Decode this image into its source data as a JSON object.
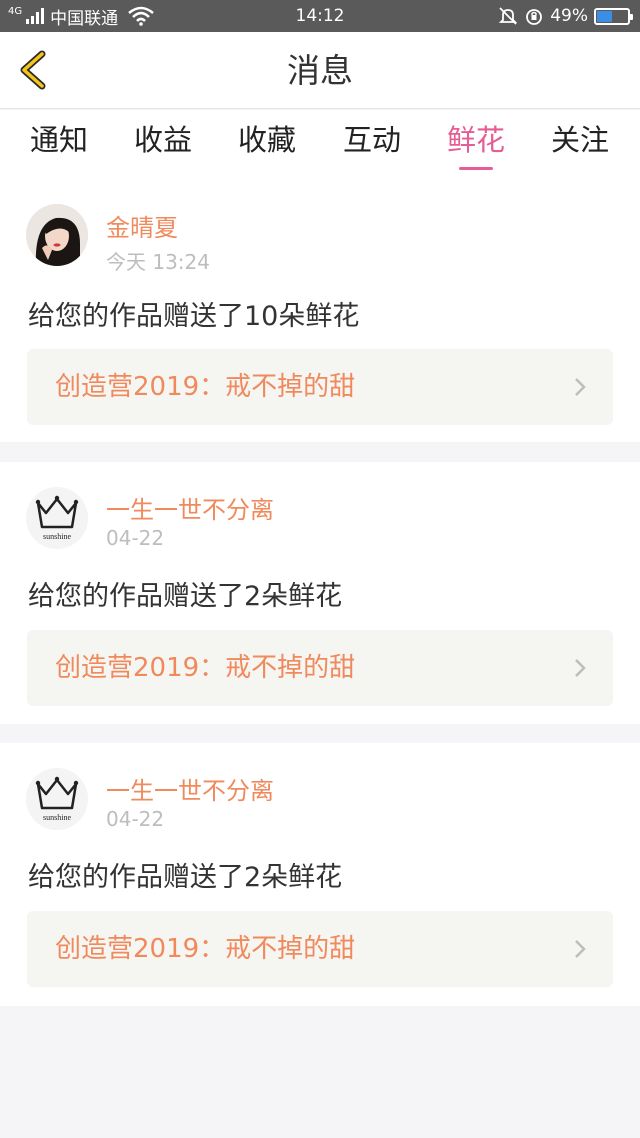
{
  "status_bar": {
    "network": "4G",
    "carrier": "中国联通",
    "time": "14:12",
    "battery": "49%",
    "battery_level": 0.49,
    "icons": [
      "signal-icon",
      "wifi-icon",
      "mute-icon",
      "alarm-icon",
      "battery-icon"
    ]
  },
  "header": {
    "title": "消息",
    "back_icon": "chevron-left-icon"
  },
  "tabs": [
    {
      "label": "通知",
      "active": false
    },
    {
      "label": "收益",
      "active": false
    },
    {
      "label": "收藏",
      "active": false
    },
    {
      "label": "互动",
      "active": false
    },
    {
      "label": "鲜花",
      "active": true
    },
    {
      "label": "关注",
      "active": false
    }
  ],
  "messages": [
    {
      "username": "金晴夏",
      "time": "今天 13:24",
      "text": "给您的作品赠送了10朵鲜花",
      "work_title": "创造营2019：戒不掉的甜",
      "avatar": "photo-avatar"
    },
    {
      "username": "一生一世不分离",
      "time": "04-22",
      "text": "给您的作品赠送了2朵鲜花",
      "work_title": "创造营2019：戒不掉的甜",
      "avatar": "crown-avatar",
      "avatar_text": "sunshine"
    },
    {
      "username": "一生一世不分离",
      "time": "04-22",
      "text": "给您的作品赠送了2朵鲜花",
      "work_title": "创造营2019：戒不掉的甜",
      "avatar": "crown-avatar",
      "avatar_text": "sunshine"
    }
  ],
  "colors": {
    "accent_pink": "#e55d94",
    "username_orange": "#f08a5d",
    "background": "#f5f5f7"
  }
}
